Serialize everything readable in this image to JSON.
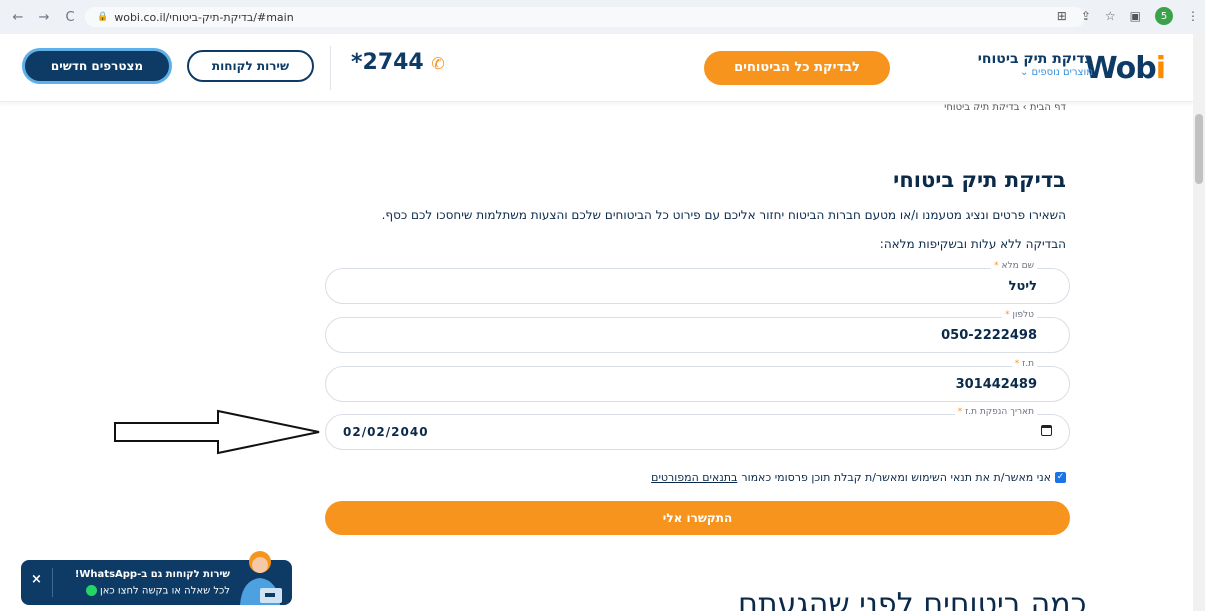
{
  "browser": {
    "back": "←",
    "forward": "→",
    "reload": "C",
    "url": "wobi.co.il/בדיקת-תיק-ביטוחי/#main",
    "profile_initial": "5"
  },
  "header": {
    "logo_main": "Wob",
    "logo_end": "i",
    "brand_title": "בדיקת תיק ביטוחי",
    "brand_subtitle": "מוצרים נוספים ⌄",
    "cta_label": "לבדיקת כל הביטוחים",
    "phone": "*2744",
    "service_label": "שירות לקוחות",
    "join_label": "מצטרפים חדשים"
  },
  "breadcrumb": "דף הבית › בדיקת תיק ביטוחי",
  "main": {
    "heading": "בדיקת תיק ביטוחי",
    "description": "השאירו פרטים ונציג מטעמנו ו/או מטעם חברות הביטוח יחזור אליכם עם פירוט כל הביטוחים שלכם והצעות משתלמות שיחסכו לכם כסף.",
    "subdescription": "הבדיקה ללא עלות ובשקיפות מלאה:"
  },
  "form": {
    "fields": [
      {
        "label": "שם מלא",
        "required_mark": "*",
        "value": "ליטל"
      },
      {
        "label": "טלפון",
        "required_mark": "*",
        "value": "050-2222498"
      },
      {
        "label": "ת.ז",
        "required_mark": "*",
        "value": "301442489"
      },
      {
        "label": "תאריך הנפקת ת.ז",
        "required_mark": "*",
        "value": "02/02/2040"
      }
    ],
    "consent_text": "אני מאשר/ת את תנאי השימוש ומאשר/ת קבלת תוכן פרסומי כאמור",
    "consent_link": "בתנאים המפורטים",
    "submit_label": "התקשרו אלי"
  },
  "bottom_heading": "כמה ביטוחים לפני שהגעתם",
  "whatsapp": {
    "close": "×",
    "line1": "שירות לקוחות גם ב-WhatsApp!",
    "line2": "לכל שאלה או בקשה לחצו כאן"
  },
  "colors": {
    "brand_navy": "#0d3b66",
    "accent_orange": "#f7941d",
    "whatsapp_green": "#25d366"
  }
}
